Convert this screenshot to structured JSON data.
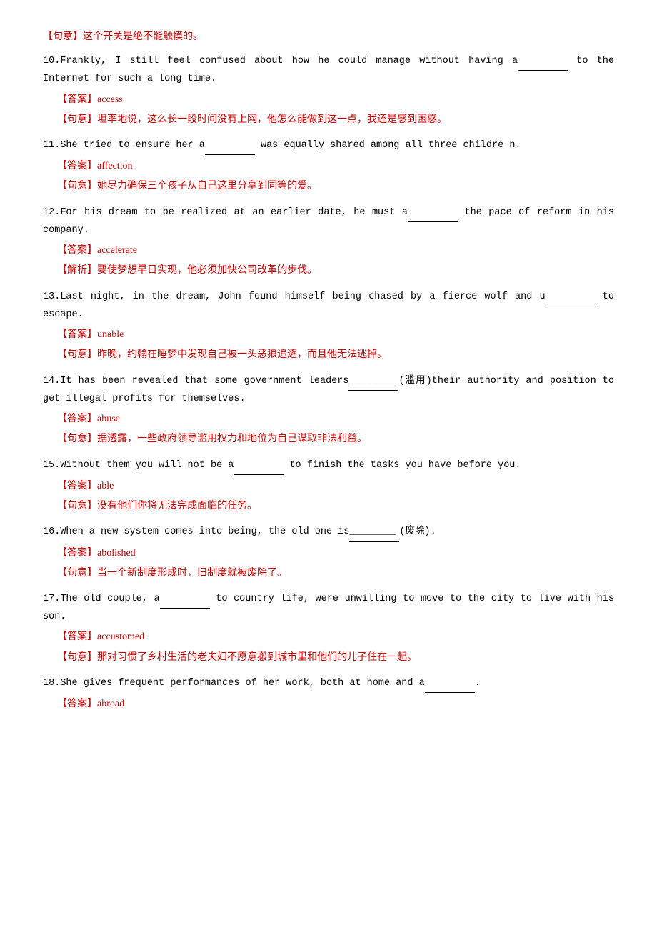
{
  "top_sentence": {
    "tag": "【句意】",
    "text": "这个开关是绝不能触摸的。"
  },
  "questions": [
    {
      "number": "10.",
      "text_before": "Frankly, I still feel confused about how he could manage without having a",
      "blank": "",
      "text_after": " to  the\n      Internet for such a long time.",
      "answer_tag": "【答案】",
      "answer": "access",
      "meaning_tag": "【句意】",
      "meaning": "坦率地说，这么长一段时间没有上网，他怎么能做到这一点，我还是感到困惑。"
    },
    {
      "number": "11.",
      "text_before": "She  tried  to  ensure  her  a",
      "blank": "",
      "text_after": "  was  equally  shared  among  all  three  childre\n      n.",
      "answer_tag": "【答案】",
      "answer": "affection",
      "meaning_tag": "【句意】",
      "meaning": "她尽力确保三个孩子从自己这里分享到同等的爱。"
    },
    {
      "number": "12.",
      "text_before": "For his dream to be realized at an earlier date, he must a",
      "blank": "",
      "text_after": " the pace of reform in\n      his company.",
      "answer_tag": "【答案】",
      "answer": "accelerate",
      "meaning_tag": "【解析】",
      "meaning": "要使梦想早日实现，他必须加快公司改革的步伐。"
    },
    {
      "number": "13.",
      "text_before": "Last night, in the dream, John found himself being chased by a fierce wolf and u",
      "blank": "",
      "text_after": " to\n      escape.",
      "answer_tag": "【答案】",
      "answer": "unable",
      "meaning_tag": "【句意】",
      "meaning": "昨晚，约翰在睡梦中发现自己被一头恶狼追逐，而且他无法逃掉。"
    },
    {
      "number": "14.",
      "text_before": "It has been revealed that some government leaders",
      "blank": "________",
      "text_after": "(滥用)their authority and position\n      to get illegal profits for themselves.",
      "answer_tag": "【答案】",
      "answer": "abuse",
      "meaning_tag": "【句意】",
      "meaning": "据透露，一些政府领导滥用权力和地位为自己谋取非法利益。"
    },
    {
      "number": "15.",
      "text_before": "Without  them  you  will  not  be  a",
      "blank": "",
      "text_after": "  to  finish  the  tasks  you  have  before\n        you.",
      "answer_tag": "【答案】",
      "answer": "able",
      "meaning_tag": "【句意】",
      "meaning": "没有他们你将无法完成面临的任务。"
    },
    {
      "number": "16.",
      "text_before": "When a new system comes into being, the old one is",
      "blank": "________",
      "text_after": "(废除).",
      "answer_tag": "【答案】",
      "answer": "abolished",
      "meaning_tag": "【句意】",
      "meaning": "当一个新制度形成时，旧制度就被废除了。"
    },
    {
      "number": "17.",
      "text_before": "The old couple, a",
      "blank": "",
      "text_after": " to  country life, were unwilling to move to the city to live with\n      his son.",
      "answer_tag": "【答案】",
      "answer": "accustomed",
      "meaning_tag": "【句意】",
      "meaning": "那对习惯了乡村生活的老夫妇不愿意搬到城市里和他们的儿子住在一起。"
    },
    {
      "number": "18.",
      "text_before": "She  gives  frequent  performances  of  her  work,  both at  home  and a",
      "blank": "",
      "text_after": ".",
      "answer_tag": "【答案】",
      "answer": "abroad",
      "meaning_tag": null,
      "meaning": null
    }
  ]
}
